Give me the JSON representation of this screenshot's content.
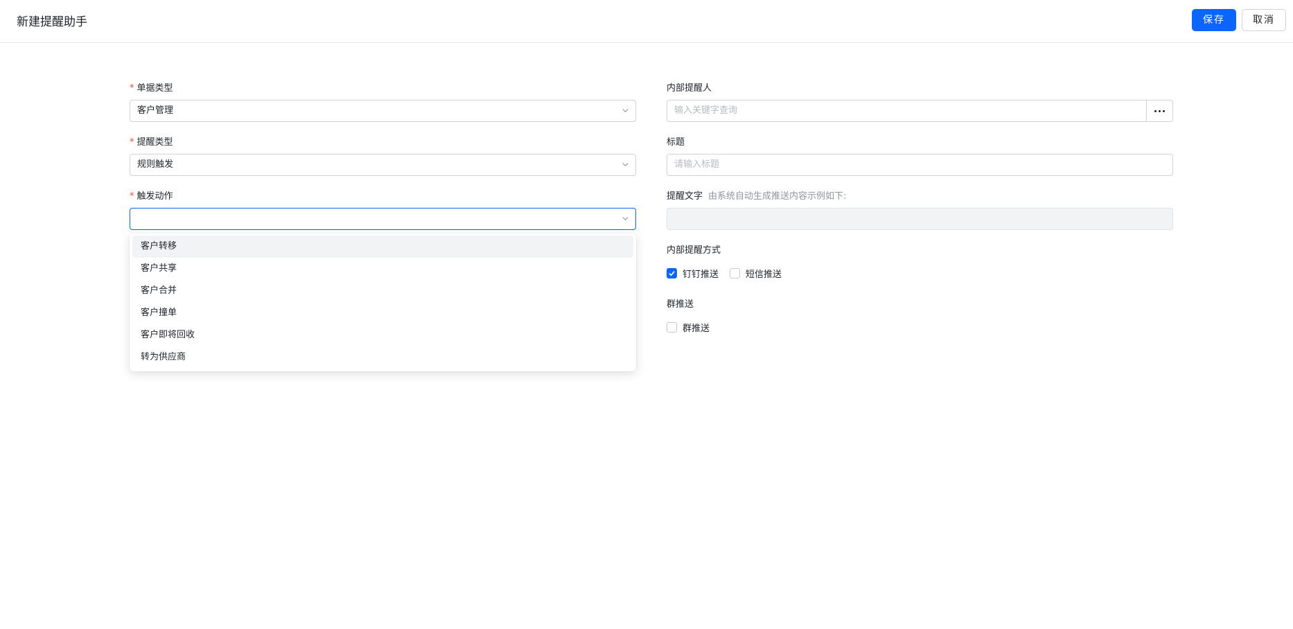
{
  "header": {
    "title": "新建提醒助手",
    "save_label": "保存",
    "cancel_label": "取消"
  },
  "form": {
    "doc_type": {
      "label": "单据类型",
      "value": "客户管理",
      "required": true
    },
    "remind_type": {
      "label": "提醒类型",
      "value": "规则触发",
      "required": true
    },
    "trigger_action": {
      "label": "触发动作",
      "value": "",
      "required": true,
      "options": [
        "客户转移",
        "客户共享",
        "客户合并",
        "客户撞单",
        "客户即将回收",
        "转为供应商"
      ]
    },
    "internal_reminder": {
      "label": "内部提醒人",
      "placeholder": "输入关键字查询"
    },
    "title_field": {
      "label": "标题",
      "placeholder": "请输入标题"
    },
    "remind_text": {
      "label": "提醒文字",
      "hint": "由系统自动生成推送内容示例如下:",
      "value": ""
    },
    "internal_method": {
      "label": "内部提醒方式",
      "options": [
        {
          "label": "钉钉推送",
          "checked": true
        },
        {
          "label": "短信推送",
          "checked": false
        }
      ]
    },
    "group_push": {
      "label": "群推送",
      "options": [
        {
          "label": "群推送",
          "checked": false
        }
      ]
    }
  },
  "colors": {
    "primary": "#0a66ff",
    "required": "#f54a45"
  }
}
